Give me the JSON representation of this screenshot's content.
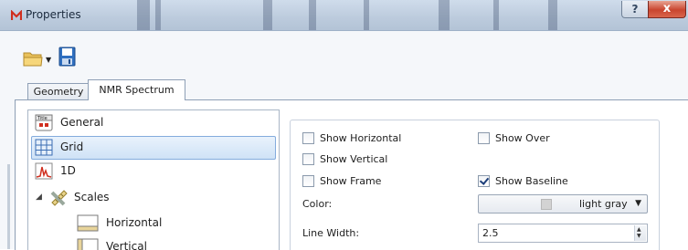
{
  "window": {
    "title": "Properties",
    "help_label": "?",
    "close_label": "x"
  },
  "tabs": [
    {
      "label": "Geometry",
      "active": false
    },
    {
      "label": "NMR Spectrum",
      "active": true
    }
  ],
  "tree": {
    "items": [
      {
        "label": "General",
        "icon": "title-icon",
        "selected": false
      },
      {
        "label": "Grid",
        "icon": "grid-icon",
        "selected": true
      },
      {
        "label": "1D",
        "icon": "spectrum-1d-icon",
        "selected": false
      },
      {
        "label": "Scales",
        "icon": "ruler-icon",
        "selected": false,
        "expanded": true
      },
      {
        "label": "Horizontal",
        "icon": "horizontal-scale-icon",
        "selected": false
      },
      {
        "label": "Vertical",
        "icon": "vertical-scale-icon",
        "selected": false
      }
    ]
  },
  "grid_settings": {
    "show_horizontal": {
      "label": "Show Horizontal",
      "checked": false
    },
    "show_vertical": {
      "label": "Show Vertical",
      "checked": false
    },
    "show_frame": {
      "label": "Show Frame",
      "checked": false
    },
    "show_over": {
      "label": "Show Over",
      "checked": false
    },
    "show_baseline": {
      "label": "Show Baseline",
      "checked": true
    },
    "color_label": "Color:",
    "color_value": "light gray",
    "color_swatch": "#d3d3d3",
    "line_width_label": "Line Width:",
    "line_width_value": "2.5"
  },
  "colors": {
    "selection": "#cfe2f6",
    "titlebar": "#c3d1e2",
    "close": "#c9452f"
  }
}
